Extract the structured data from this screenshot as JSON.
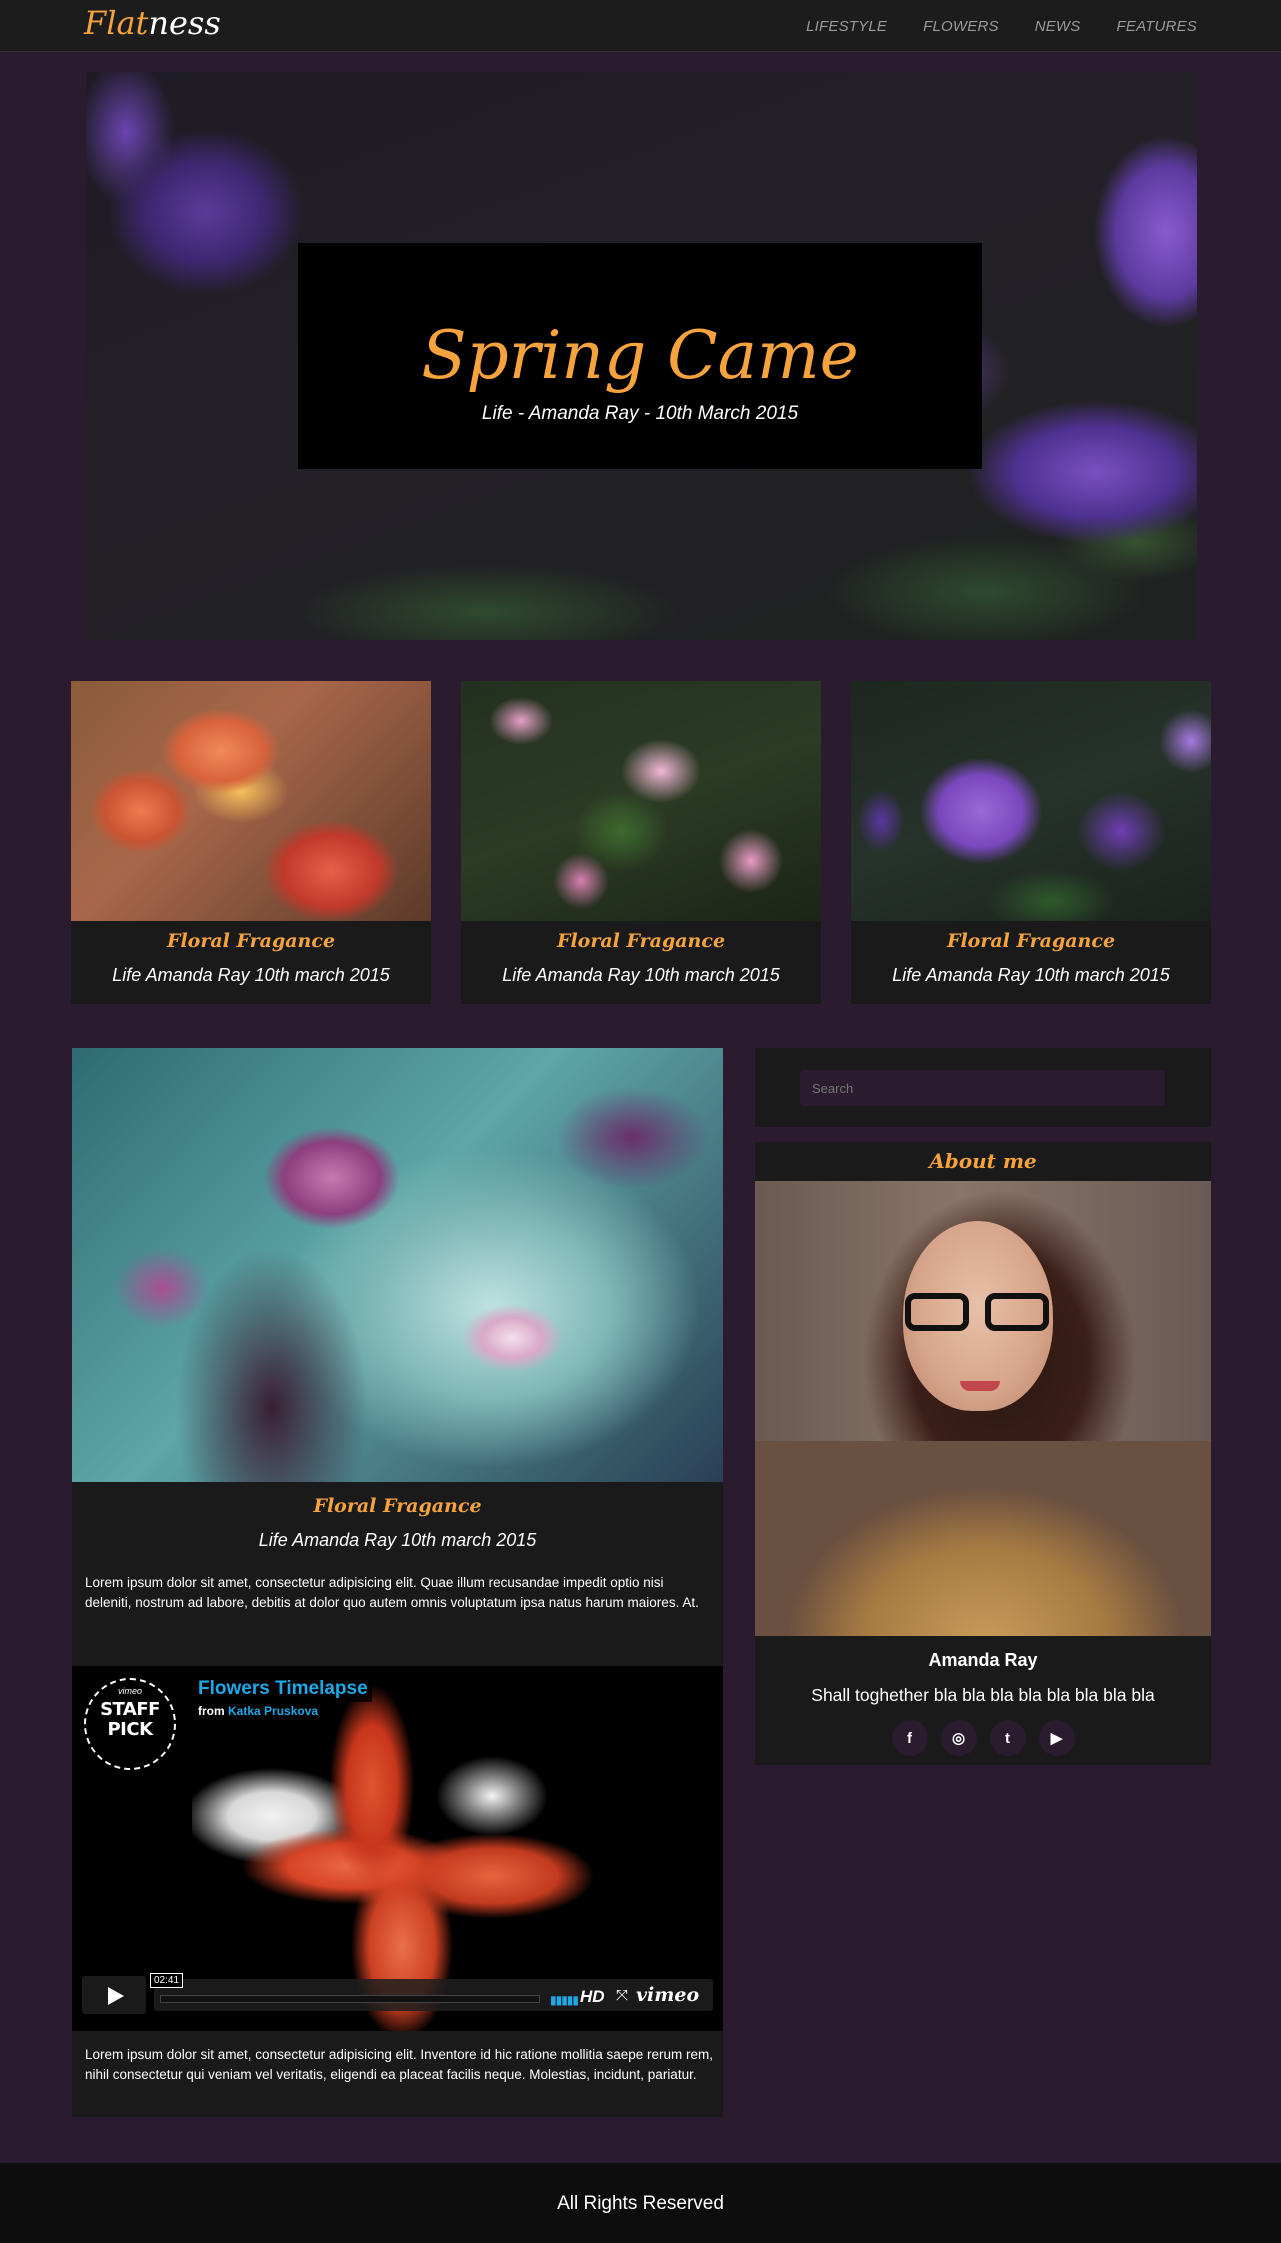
{
  "navbar": {
    "brand_accent": "Flat",
    "brand_rest": "ness",
    "links": [
      "LIFESTYLE",
      "FLOWERS",
      "NEWS",
      "FEATURES"
    ]
  },
  "hero": {
    "title": "Spring Came",
    "subtitle": "Life - Amanda Ray - 10th March 2015"
  },
  "cards": [
    {
      "title": "Floral Fragance",
      "meta": "Life Amanda Ray 10th march 2015"
    },
    {
      "title": "Floral Fragance",
      "meta": "Life Amanda Ray 10th march 2015"
    },
    {
      "title": "Floral Fragance",
      "meta": "Life Amanda Ray 10th march 2015"
    }
  ],
  "post": {
    "title": "Floral Fragance",
    "meta": "Life Amanda Ray 10th march 2015",
    "text1": "Lorem ipsum dolor sit amet, consectetur adipisicing elit. Quae illum recusandae impedit optio nisi deleniti, nostrum ad labore, debitis at dolor quo autem omnis voluptatum ipsa natus harum maiores. At.",
    "text2": "Lorem ipsum dolor sit amet, consectetur adipisicing elit. Inventore id hic ratione mollitia saepe rerum rem, nihil consectetur qui veniam vel veritatis, eligendi ea placeat facilis neque. Molestias, incidunt, pariatur."
  },
  "video": {
    "badge_top": "vimeo",
    "badge_line1": "STAFF",
    "badge_line2": "PICK",
    "title": "Flowers Timelapse",
    "from_label": "from",
    "author": "Katka Pruskova",
    "time": "02:41",
    "hd": "HD",
    "logo": "vimeo"
  },
  "sidebar": {
    "search_placeholder": "Search",
    "about_title": "About me",
    "name": "Amanda Ray",
    "description": "Shall toghether bla bla bla bla bla bla bla bla",
    "socials": [
      {
        "icon": "facebook-icon",
        "glyph": "f"
      },
      {
        "icon": "instagram-icon",
        "glyph": "◎"
      },
      {
        "icon": "twitter-icon",
        "glyph": "t"
      },
      {
        "icon": "youtube-icon",
        "glyph": "▶"
      }
    ]
  },
  "footer": {
    "text": "All Rights Reserved"
  },
  "colors": {
    "accent": "#f6a33e",
    "background": "#2a1b2f",
    "panel": "#1a1a1a",
    "vimeo_blue": "#1ea8e8"
  }
}
